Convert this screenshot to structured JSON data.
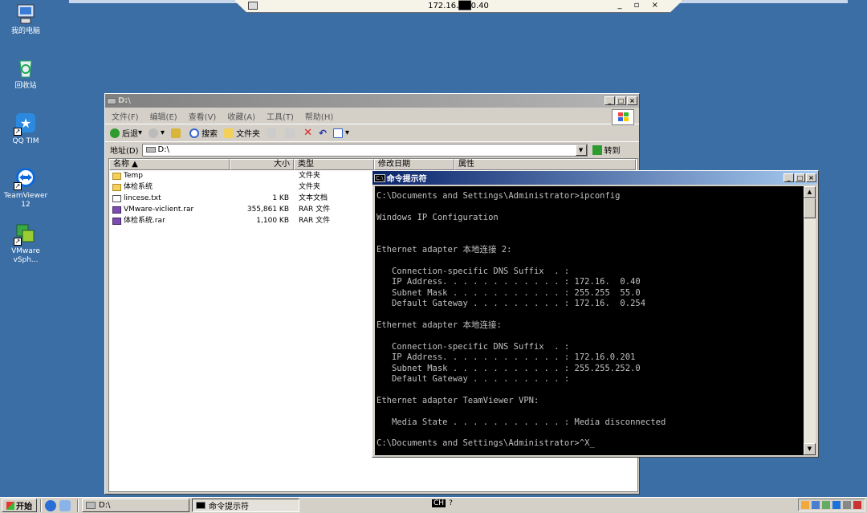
{
  "remote_bar": {
    "host": "172.16.██0.40",
    "controls": "_ ▫ ×"
  },
  "desktop_icons": [
    {
      "label": "我的电脑",
      "icon": "my-computer-icon"
    },
    {
      "label": "回收站",
      "icon": "recycle-bin-icon"
    },
    {
      "label": "QQ TIM",
      "icon": "qq-tim-icon"
    },
    {
      "label": "TeamViewer 12",
      "icon": "teamviewer-icon"
    },
    {
      "label": "VMware vSph...",
      "icon": "vmware-icon"
    }
  ],
  "explorer": {
    "title": "D:\\",
    "menu": [
      "文件(F)",
      "编辑(E)",
      "查看(V)",
      "收藏(A)",
      "工具(T)",
      "帮助(H)"
    ],
    "toolbar": {
      "back": "后退",
      "search": "搜索",
      "folders": "文件夹"
    },
    "address_label": "地址(D)",
    "address_value": "D:\\",
    "go": "转到",
    "columns": [
      "名称 ▲",
      "大小",
      "类型",
      "修改日期",
      "属性"
    ],
    "files": [
      {
        "name": "Temp",
        "size": "",
        "type": "文件夹",
        "icon": "folder-icon"
      },
      {
        "name": "体检系统",
        "size": "",
        "type": "文件夹",
        "icon": "folder-icon"
      },
      {
        "name": "lincese.txt",
        "size": "1 KB",
        "type": "文本文档",
        "icon": "text-file-icon"
      },
      {
        "name": "VMware-viclient.rar",
        "size": "355,861 KB",
        "type": "RAR 文件",
        "icon": "rar-file-icon"
      },
      {
        "name": "体检系统.rar",
        "size": "1,100 KB",
        "type": "RAR 文件",
        "icon": "rar-file-icon"
      }
    ]
  },
  "cmd": {
    "title": "命令提示符",
    "lines": [
      "C:\\Documents and Settings\\Administrator>ipconfig",
      "",
      "Windows IP Configuration",
      "",
      "",
      "Ethernet adapter 本地连接 2:",
      "",
      "   Connection-specific DNS Suffix  . :",
      "   IP Address. . . . . . . . . . . . : 172.16.  0.40",
      "   Subnet Mask . . . . . . . . . . . : 255.255  55.0",
      "   Default Gateway . . . . . . . . . : 172.16.  0.254",
      "",
      "Ethernet adapter 本地连接:",
      "",
      "   Connection-specific DNS Suffix  . :",
      "   IP Address. . . . . . . . . . . . : 172.16.0.201",
      "   Subnet Mask . . . . . . . . . . . : 255.255.252.0",
      "   Default Gateway . . . . . . . . . :",
      "",
      "Ethernet adapter TeamViewer VPN:",
      "",
      "   Media State . . . . . . . . . . . : Media disconnected",
      "",
      "C:\\Documents and Settings\\Administrator>^X_"
    ]
  },
  "taskbar": {
    "start": "开始",
    "tasks": [
      {
        "label": "D:\\",
        "pressed": false
      },
      {
        "label": "命令提示符",
        "pressed": true
      }
    ],
    "ime": "CH"
  },
  "colors": {
    "desktop": "#3a6ea5",
    "title_active": "#0a246a",
    "window_face": "#d4d0c8"
  }
}
